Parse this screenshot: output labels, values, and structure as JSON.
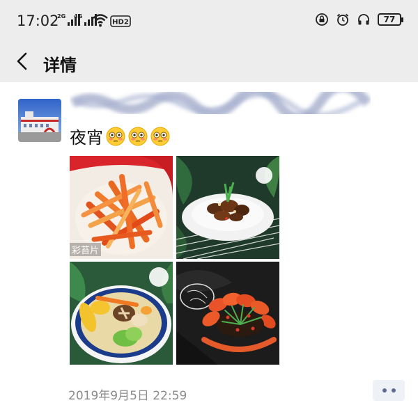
{
  "status_bar": {
    "time": "17:02",
    "signal_1_tag": "2G",
    "signal_2_tag": "4G",
    "hd_label": "HD2",
    "battery": "77"
  },
  "nav": {
    "back_icon": "chevron-left-icon",
    "title": "详情"
  },
  "post": {
    "text": "夜宵",
    "emojis": [
      "flushed-face",
      "flushed-face",
      "flushed-face"
    ],
    "photos": [
      {
        "name": "shredded-potato-dish",
        "label": "彩苔片"
      },
      {
        "name": "braised-meat-dish",
        "label": ""
      },
      {
        "name": "corn-soup-dish",
        "label": ""
      },
      {
        "name": "crayfish-dish",
        "label": ""
      }
    ],
    "timestamp": "2019年9月5日 22:59"
  },
  "colors": {
    "header_bg": "#ededed",
    "link_blue": "#5b6b93",
    "timestamp_gray": "#8a8a8a"
  }
}
